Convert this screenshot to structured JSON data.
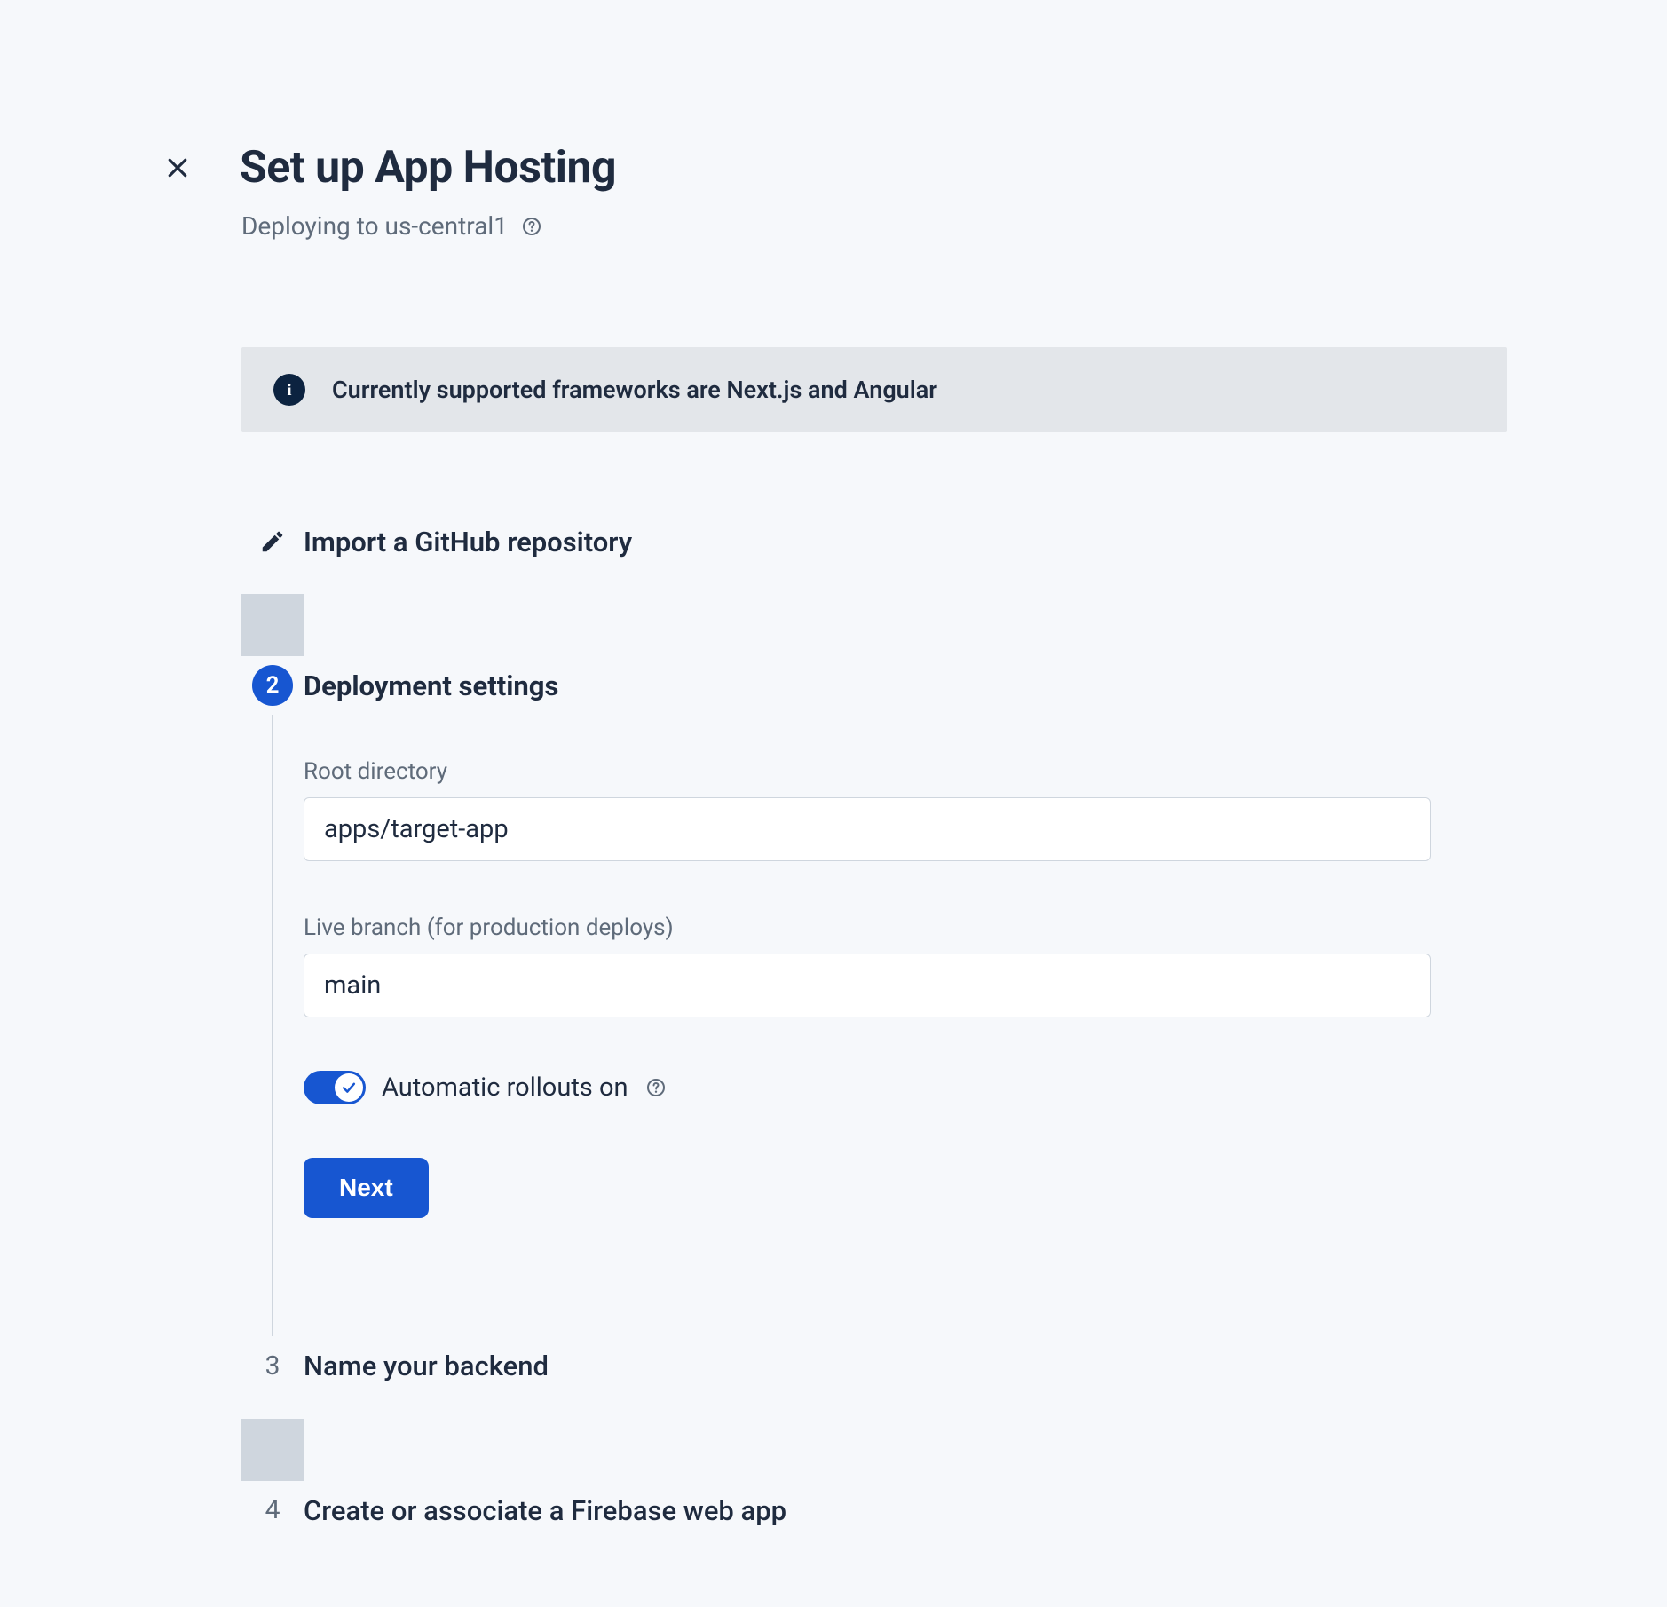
{
  "page_title": "Set up App Hosting",
  "subheader": "Deploying to us-central1",
  "info_banner": "Currently supported frameworks are Next.js and Angular",
  "steps": {
    "step1": {
      "title": "Import a GitHub repository"
    },
    "step2": {
      "number": "2",
      "title": "Deployment settings",
      "root_dir_label": "Root directory",
      "root_dir_value": "apps/target-app",
      "branch_label": "Live branch (for production deploys)",
      "branch_value": "main",
      "toggle_label": "Automatic rollouts on",
      "next_button": "Next"
    },
    "step3": {
      "number": "3",
      "title": "Name your backend"
    },
    "step4": {
      "number": "4",
      "title": "Create or associate a Firebase web app"
    }
  }
}
